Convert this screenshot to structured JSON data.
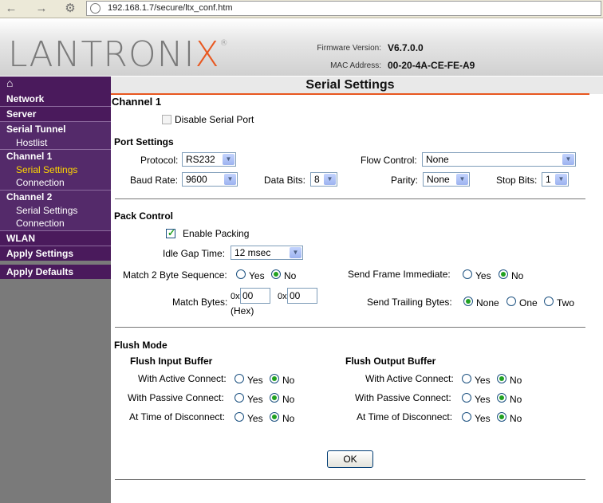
{
  "browser": {
    "url": "192.168.1.7/secure/ltx_conf.htm"
  },
  "header": {
    "logo_text": "LANTRONIX",
    "firmware_label": "Firmware Version:",
    "firmware_value": "V6.7.0.0",
    "mac_label": "MAC Address:",
    "mac_value": "00-20-4A-CE-FE-A9"
  },
  "sidebar": {
    "home_icon": "home-icon",
    "items": [
      {
        "label": "Network"
      },
      {
        "label": "Server"
      },
      {
        "label": "Serial Tunnel"
      },
      {
        "label": "Hostlist"
      },
      {
        "label": "Channel 1"
      },
      {
        "label": "Serial Settings"
      },
      {
        "label": "Connection"
      },
      {
        "label": "Channel 2"
      },
      {
        "label": "Serial Settings"
      },
      {
        "label": "Connection"
      },
      {
        "label": "WLAN"
      },
      {
        "label": "Apply Settings"
      },
      {
        "label": "Apply Defaults"
      }
    ]
  },
  "page": {
    "title": "Serial Settings",
    "channel": "Channel 1",
    "disable_serial_port": {
      "label": "Disable Serial Port",
      "checked": false
    }
  },
  "port_settings": {
    "heading": "Port Settings",
    "protocol": {
      "label": "Protocol:",
      "value": "RS232"
    },
    "flow_control": {
      "label": "Flow Control:",
      "value": "None"
    },
    "baud_rate": {
      "label": "Baud Rate:",
      "value": "9600"
    },
    "data_bits": {
      "label": "Data Bits:",
      "value": "8"
    },
    "parity": {
      "label": "Parity:",
      "value": "None"
    },
    "stop_bits": {
      "label": "Stop Bits:",
      "value": "1"
    }
  },
  "pack_control": {
    "heading": "Pack Control",
    "enable_packing": {
      "label": "Enable Packing",
      "checked": true
    },
    "idle_gap": {
      "label": "Idle Gap Time:",
      "value": "12 msec"
    },
    "match2": {
      "label": "Match 2 Byte Sequence:",
      "yes": "Yes",
      "no": "No",
      "selected": "No"
    },
    "send_frame": {
      "label": "Send Frame Immediate:",
      "yes": "Yes",
      "no": "No",
      "selected": "No"
    },
    "match_bytes": {
      "label": "Match Bytes:",
      "prefix1": "0x",
      "value1": "00",
      "prefix2": "0x",
      "value2": "00",
      "hex": "(Hex)"
    },
    "trailing": {
      "label": "Send Trailing Bytes:",
      "none": "None",
      "one": "One",
      "two": "Two",
      "selected": "None"
    }
  },
  "flush_mode": {
    "heading": "Flush Mode",
    "input_heading": "Flush Input Buffer",
    "output_heading": "Flush Output Buffer",
    "rows": [
      {
        "label": "With Active Connect:",
        "yes": "Yes",
        "no": "No"
      },
      {
        "label": "With Passive Connect:",
        "yes": "Yes",
        "no": "No"
      },
      {
        "label": "At Time of Disconnect:",
        "yes": "Yes",
        "no": "No"
      }
    ]
  },
  "ok_button": "OK",
  "colors": {
    "accent": "#e8571f",
    "sidebar": "#4a1a5c",
    "selected": "#ffd700"
  }
}
